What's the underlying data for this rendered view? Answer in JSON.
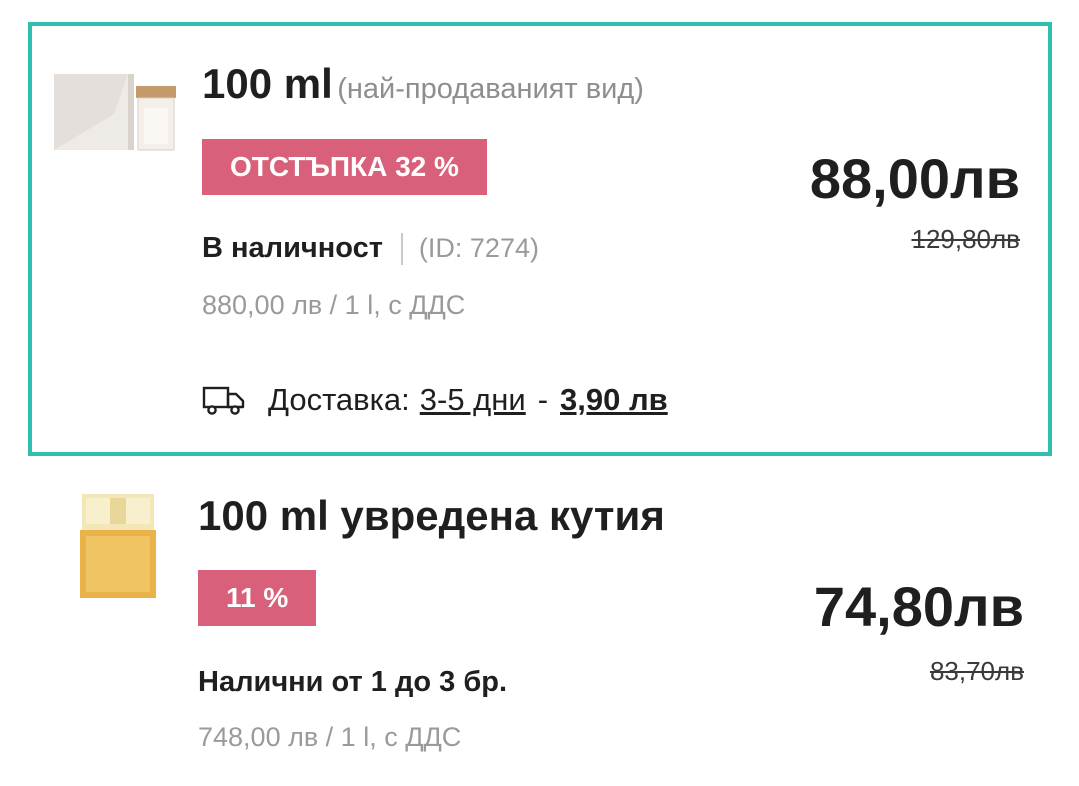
{
  "variants": [
    {
      "size": "100 ml",
      "note": "(най-продаваният вид)",
      "badge": "ОТСТЪПКА 32 %",
      "price": "88,00лв",
      "old_price": "129,80лв",
      "stock": "В наличност",
      "sku_id": "(ID: 7274)",
      "unit_price": "880,00 лв / 1 l, с ДДС",
      "delivery": {
        "label": "Доставка:",
        "days": "3-5 дни",
        "dash": "-",
        "cost": "3,90 лв"
      }
    },
    {
      "size": "100 ml увредена кутия",
      "badge": "11 %",
      "price": "74,80лв",
      "old_price": "83,70лв",
      "stock": "Налични от 1 до 3 бр.",
      "unit_price": "748,00 лв / 1 l, с ДДС"
    }
  ],
  "colors": {
    "selected_border": "#2fc0b0",
    "badge_bg": "#d9607a"
  },
  "icons": {
    "delivery": "truck-icon"
  }
}
